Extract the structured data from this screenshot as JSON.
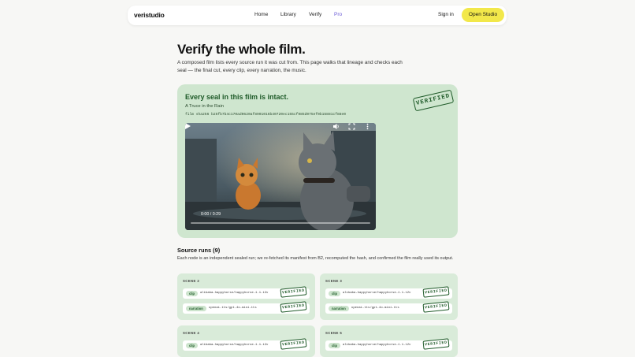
{
  "nav": {
    "logo": "veristudio",
    "links": [
      "Home",
      "Library",
      "Verify",
      "Pro"
    ],
    "sign_in": "Sign in",
    "cta": "Open Studio"
  },
  "hero": {
    "title": "Verify the whole film.",
    "description": "A composed film lists every source run it was cut from. This page walks that lineage and checks each seal — the final cut, every clip, every narration, the music."
  },
  "seal_card": {
    "title": "Every seal in this film is intact.",
    "subtitle": "A Truce in the Rain",
    "hash": "film sha256 b25fb7b4c170ad0620af8901016b40720ec155cf985d075ef0b15881cf88e0",
    "stamp": "VERIFIED",
    "video": {
      "time": "0:00 / 0:29",
      "progress": 0.0
    }
  },
  "runs": {
    "title": "Source runs (9)",
    "description": "Each node is an independent sealed run; we re-fetched its manifest from B2, recomputed the hash, and confirmed the film really used its output."
  },
  "scenes": [
    {
      "label": "SCENE 2",
      "rows": [
        {
          "kind": "clip",
          "model": "alibaba-happyhorse/happyhorse-1.1-t2v",
          "stamp": "VERIFIED"
        },
        {
          "kind": "narration",
          "model": "openai-tts/gpt-4o-mini-tts",
          "stamp": "VERIFIED"
        }
      ]
    },
    {
      "label": "SCENE 3",
      "rows": [
        {
          "kind": "clip",
          "model": "alibaba-happyhorse/happyhorse-1.1-t2v",
          "stamp": "VERIFIED"
        },
        {
          "kind": "narration",
          "model": "openai-tts/gpt-4o-mini-tts",
          "stamp": "VERIFIED"
        }
      ]
    },
    {
      "label": "SCENE 4",
      "rows": [
        {
          "kind": "clip",
          "model": "alibaba-happyhorse/happyhorse-1.1-t2v",
          "stamp": "VERIFIED"
        }
      ]
    },
    {
      "label": "SCENE 5",
      "rows": [
        {
          "kind": "clip",
          "model": "alibaba-happyhorse/happyhorse-1.1-t2v",
          "stamp": "VERIFIED"
        }
      ]
    }
  ],
  "colors": {
    "accent_yellow": "#f2e84a",
    "seal_green": "#1e5a28",
    "card_green": "#cfe6cf",
    "pro_purple": "#6b5bd6"
  },
  "icons": [
    "play-icon",
    "volume-icon",
    "fullscreen-icon",
    "more-options-icon"
  ]
}
